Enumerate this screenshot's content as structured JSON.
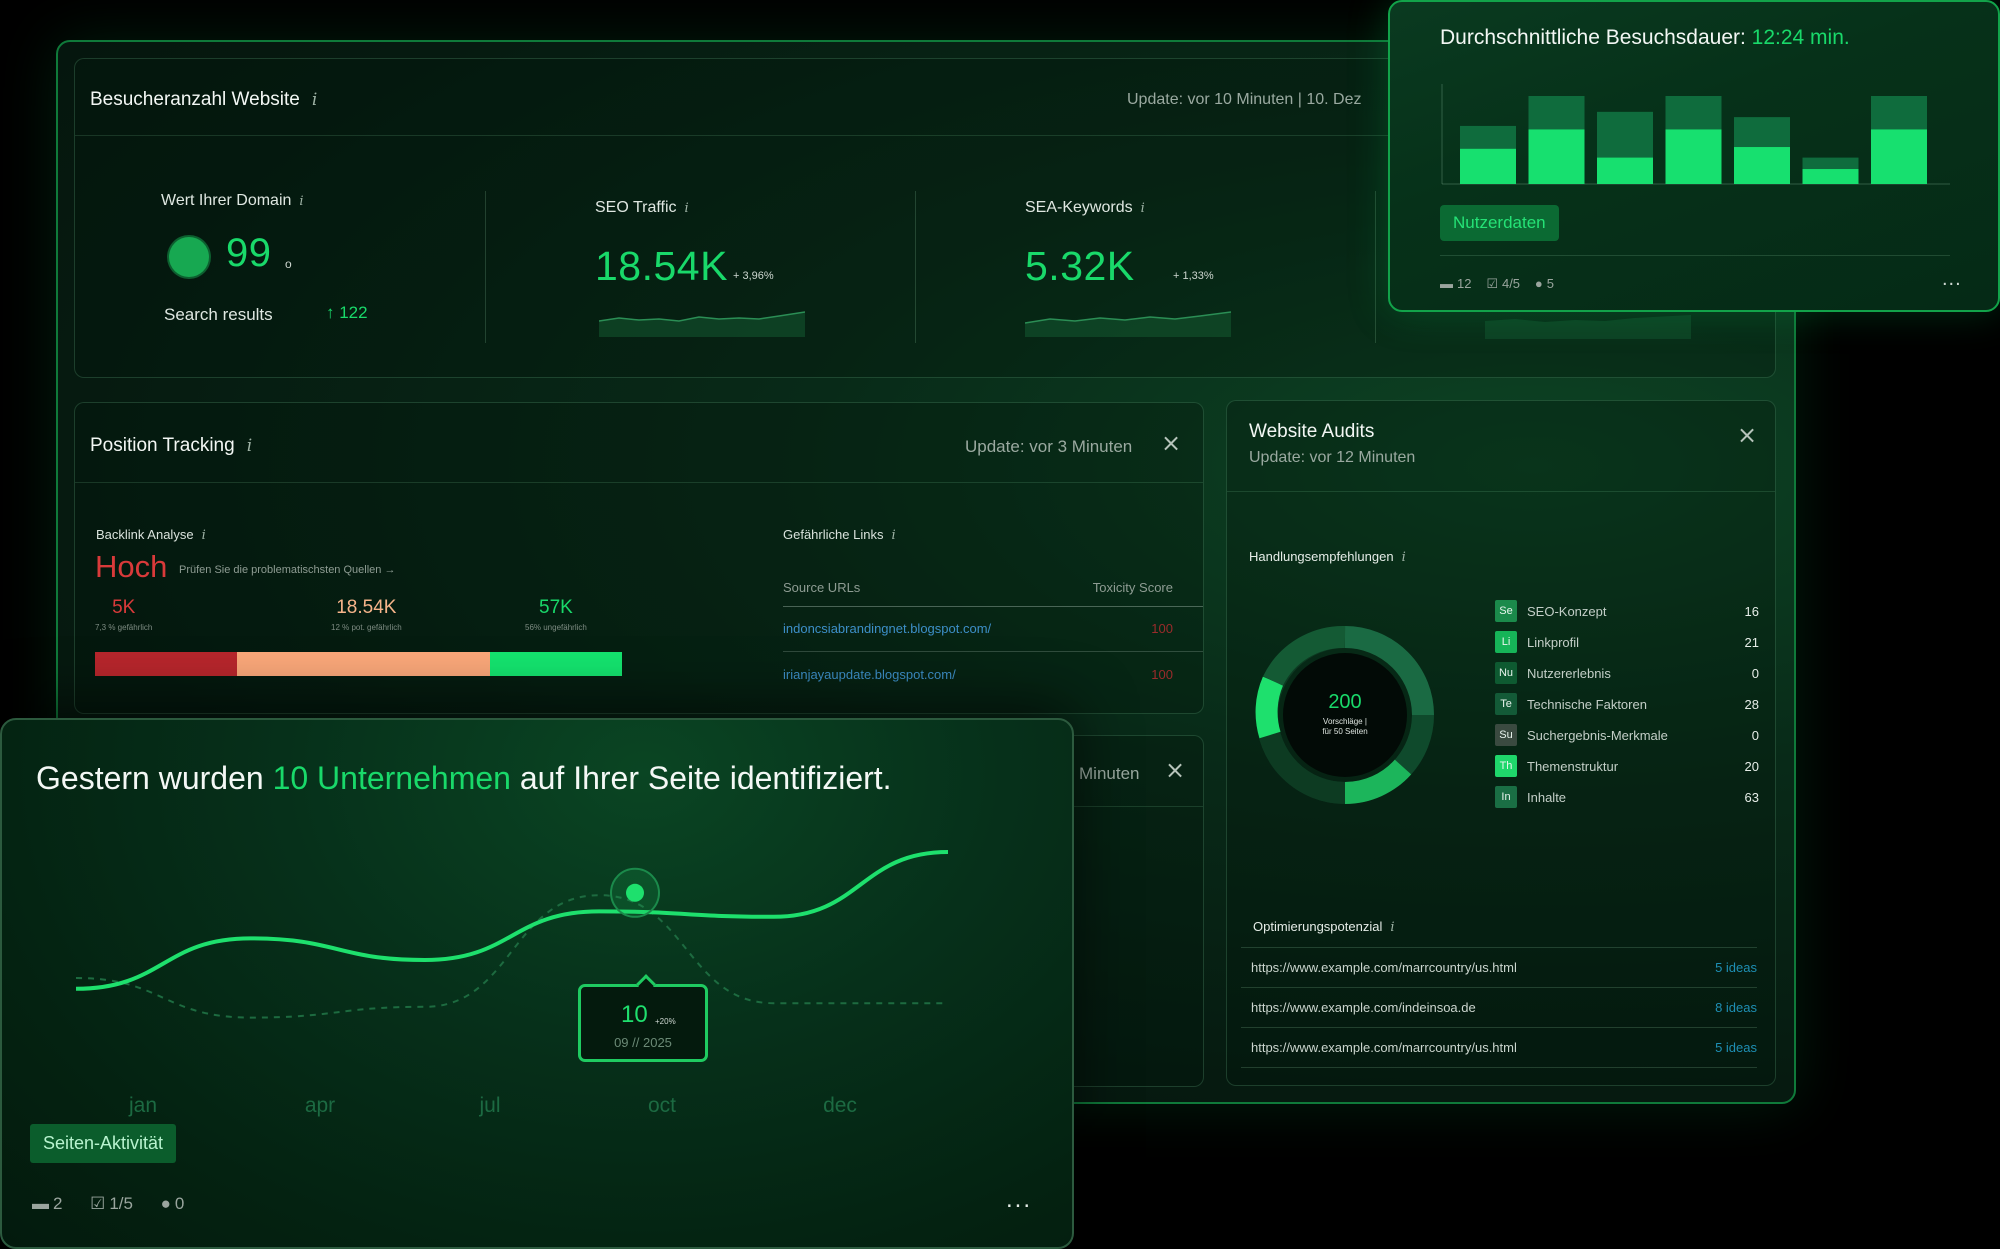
{
  "visitors": {
    "title": "Besucheranzahl Website",
    "update": "Update: vor 10 Minuten   |  10. Dez",
    "domain": {
      "label": "Wert Ihrer Domain",
      "value": "99",
      "unit": "o",
      "search_label": "Search results",
      "search_delta": "↑ 122"
    },
    "seo": {
      "label": "SEO Traffic",
      "value": "18.54K",
      "delta": "+ 3,96%"
    },
    "sea": {
      "label": "SEA-Keywords",
      "value": "5.32K",
      "delta": "+ 1,33%"
    }
  },
  "visit_popup": {
    "title_prefix": "Durchschnittliche Besuchsdauer: ",
    "title_value": "12:24 min.",
    "tag": "Nutzerdaten",
    "meta": {
      "folders": "12",
      "tasks": "4/5",
      "comments": "5"
    },
    "more": "...",
    "bars": [
      {
        "total": 0.66,
        "inner": 0.4
      },
      {
        "total": 1.0,
        "inner": 0.62
      },
      {
        "total": 0.82,
        "inner": 0.3
      },
      {
        "total": 1.0,
        "inner": 0.62
      },
      {
        "total": 0.76,
        "inner": 0.42
      },
      {
        "total": 0.3,
        "inner": 0.17
      },
      {
        "total": 1.0,
        "inner": 0.62
      }
    ]
  },
  "position": {
    "title": "Position Tracking",
    "update": "Update: vor 3 Minuten",
    "backlink_label": "Backlink Analyse",
    "level": "Hoch",
    "level_hint": "Prüfen Sie die problematischsten Quellen",
    "stats": [
      {
        "value": "5K",
        "caption": "7,3 % gefährlich",
        "color": "#d93a3a"
      },
      {
        "value": "18.54K",
        "caption": "12 % pot. gefährlich",
        "color": "#f6b48a"
      },
      {
        "value": "57K",
        "caption": "56% ungefährlich",
        "color": "#19d96a"
      }
    ],
    "bar_segments": [
      {
        "fraction": 0.27,
        "color": "#b8262c"
      },
      {
        "fraction": 0.48,
        "color": "#fba87a"
      },
      {
        "fraction": 0.25,
        "color": "#14e56f"
      }
    ],
    "links_label": "Gefährliche Links",
    "links_headers": [
      "Source URLs",
      "Toxicity Score"
    ],
    "links": [
      {
        "url": "indoncsiabrandingnet.blogspot.com/",
        "score": "100"
      },
      {
        "url": "irianjayaupdate.blogspot.com/",
        "score": "100"
      }
    ]
  },
  "second_card": {
    "update_fragment": "Minuten"
  },
  "audits": {
    "title": "Website Audits",
    "update": "Update: vor 12 Minuten",
    "recommend_label": "Handlungsempfehlungen",
    "donut_total": "200",
    "donut_caption_1": "Vorschläge |",
    "donut_caption_2": "für 50 Seiten",
    "items": [
      {
        "abbr": "Se",
        "label": "SEO-Konzept",
        "count": "16",
        "color": "#1b8a4b"
      },
      {
        "abbr": "Li",
        "label": "Linkprofil",
        "count": "21",
        "color": "#16b458"
      },
      {
        "abbr": "Nu",
        "label": "Nutzererlebnis",
        "count": "0",
        "color": "#0e5a31"
      },
      {
        "abbr": "Te",
        "label": "Technische Faktoren",
        "count": "28",
        "color": "#135a37"
      },
      {
        "abbr": "Su",
        "label": "Suchergebnis-Merkmale",
        "count": "0",
        "color": "#3a4a40"
      },
      {
        "abbr": "Th",
        "label": "Themenstruktur",
        "count": "20",
        "color": "#1fd76b"
      },
      {
        "abbr": "In",
        "label": "Inhalte",
        "count": "63",
        "color": "#1a6e44"
      }
    ],
    "optimize_label": "Optimierungspotenzial",
    "urls": [
      {
        "url": "https://www.example.com/marrcountry/us.html",
        "ideas": "5 ideas"
      },
      {
        "url": "https://www.example.com/indeinsoa.de",
        "ideas": "8 ideas"
      },
      {
        "url": "https://www.example.com/marrcountry/us.html",
        "ideas": "5 ideas"
      }
    ]
  },
  "companies": {
    "headline_prefix": "Gestern wurden ",
    "headline_highlight": "10 Unternehmen",
    "headline_suffix": " auf Ihrer Seite identifiziert.",
    "tooltip_value": "10",
    "tooltip_delta": "+20%",
    "tooltip_date": "09 // 2025",
    "tag": "Seiten-Aktivität",
    "meta": {
      "folders": "2",
      "tasks": "1/5",
      "comments": "0"
    },
    "more": "..."
  },
  "chart_data": {
    "type": "line",
    "x": [
      "jan",
      "apr",
      "jul",
      "oct",
      "dec"
    ],
    "series": [
      {
        "values": [
          2.4,
          5.2,
          4.0,
          6.7,
          6.4,
          10.0
        ]
      },
      {
        "values": [
          3.0,
          0.8,
          1.4,
          7.6,
          1.6,
          1.6
        ]
      }
    ],
    "highlight": {
      "value": 10,
      "delta": "+20%",
      "date": "09 // 2025"
    }
  },
  "colors": {
    "accent": "#19d96a",
    "danger": "#d93a3a",
    "panel": "#04120b"
  }
}
